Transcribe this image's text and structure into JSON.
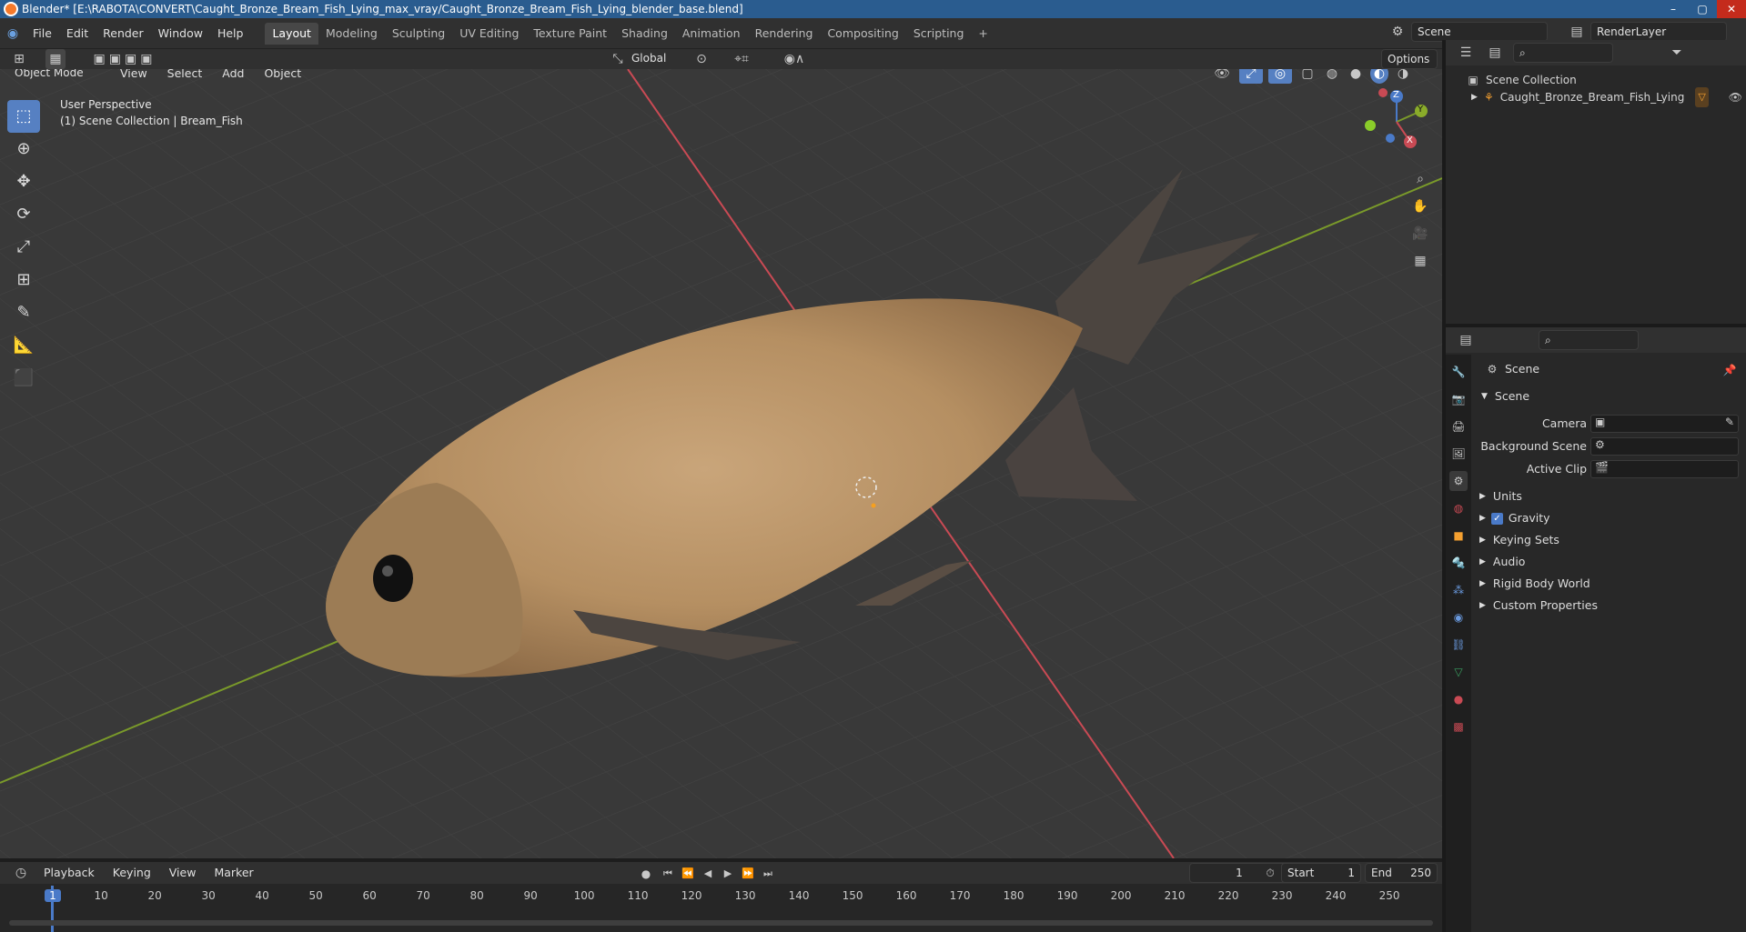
{
  "window": {
    "title": "Blender* [E:\\RABOTA\\CONVERT\\Caught_Bronze_Bream_Fish_Lying_max_vray/Caught_Bronze_Bream_Fish_Lying_blender_base.blend]",
    "controls": [
      "–",
      "▢",
      "✕"
    ]
  },
  "menu": {
    "items": [
      "File",
      "Edit",
      "Render",
      "Window",
      "Help"
    ]
  },
  "workspaces": {
    "tabs": [
      "Layout",
      "Modeling",
      "Sculpting",
      "UV Editing",
      "Texture Paint",
      "Shading",
      "Animation",
      "Rendering",
      "Compositing",
      "Scripting"
    ],
    "active": "Layout",
    "add": "+"
  },
  "scene_selector": {
    "scene": "Scene",
    "view_layer": "RenderLayer"
  },
  "viewport_header": {
    "transform_orientation": "Global",
    "options": "Options"
  },
  "viewport_header2": {
    "mode": "Object Mode",
    "menus": [
      "View",
      "Select",
      "Add",
      "Object"
    ]
  },
  "viewport": {
    "perspective": "User Perspective",
    "collection_info": "(1) Scene Collection | Bream_Fish"
  },
  "gizmo": {
    "z": "Z",
    "y": "Y",
    "x": "X"
  },
  "outliner": {
    "root": "Scene Collection",
    "item": "Caught_Bronze_Bream_Fish_Lying"
  },
  "properties": {
    "context": "Scene",
    "panel": "Scene",
    "camera_label": "Camera",
    "bg_scene_label": "Background Scene",
    "active_clip_label": "Active Clip",
    "subpanels": [
      "Units",
      "Gravity",
      "Keying Sets",
      "Audio",
      "Rigid Body World",
      "Custom Properties"
    ],
    "gravity_checked": true
  },
  "timeline": {
    "menus": [
      "Playback",
      "Keying",
      "View",
      "Marker"
    ],
    "current_frame": "1",
    "start_label": "Start",
    "start": "1",
    "end_label": "End",
    "end": "250",
    "ticks": [
      "1",
      "10",
      "20",
      "30",
      "40",
      "50",
      "60",
      "70",
      "80",
      "90",
      "100",
      "110",
      "120",
      "130",
      "140",
      "150",
      "160",
      "170",
      "180",
      "190",
      "200",
      "210",
      "220",
      "230",
      "240",
      "250"
    ]
  },
  "colors": {
    "accent": "#5680c2",
    "x_axis": "#c94a54",
    "y_axis": "#7a9a2a",
    "active_frame": "#4a7ac8"
  }
}
